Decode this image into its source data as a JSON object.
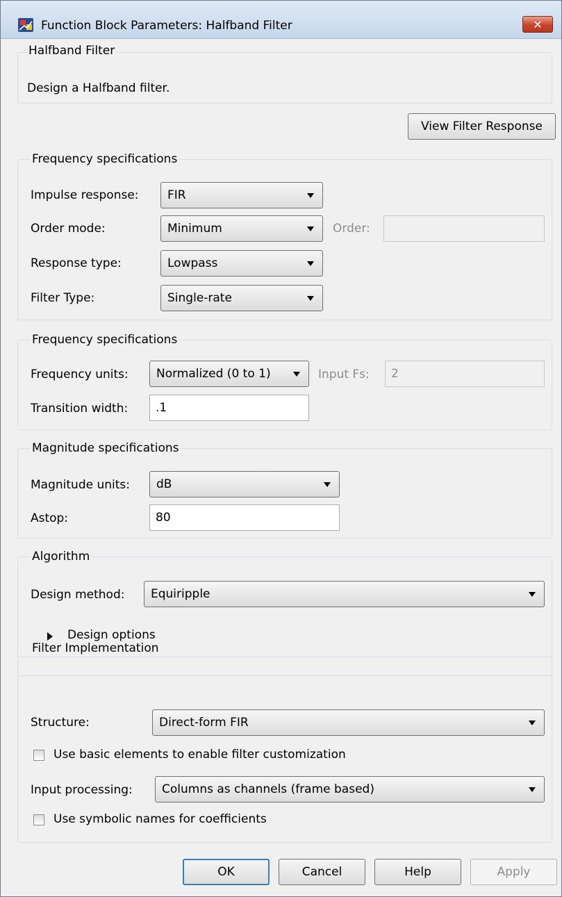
{
  "window": {
    "title": "Function Block Parameters: Halfband Filter",
    "close_glyph": "✕"
  },
  "header": {
    "group_title": "Halfband Filter",
    "description": "Design a Halfband filter."
  },
  "view_filter_response_label": "View Filter Response",
  "freq_spec1": {
    "title": "Frequency specifications",
    "impulse_label": "Impulse response:",
    "impulse_value": "FIR",
    "order_mode_label": "Order mode:",
    "order_mode_value": "Minimum",
    "order_label": "Order:",
    "order_value": "",
    "response_type_label": "Response type:",
    "response_type_value": "Lowpass",
    "filter_type_label": "Filter Type:",
    "filter_type_value": "Single-rate"
  },
  "freq_spec2": {
    "title": "Frequency specifications",
    "units_label": "Frequency units:",
    "units_value": "Normalized (0 to 1)",
    "input_fs_label": "Input Fs:",
    "input_fs_value": "2",
    "transition_label": "Transition width:",
    "transition_value": ".1"
  },
  "magnitude": {
    "title": "Magnitude specifications",
    "units_label": "Magnitude units:",
    "units_value": "dB",
    "astop_label": "Astop:",
    "astop_value": "80"
  },
  "algorithm": {
    "title": "Algorithm",
    "design_method_label": "Design method:",
    "design_method_value": "Equiripple",
    "design_options_label": "Design options"
  },
  "implementation": {
    "title": "Filter Implementation",
    "structure_label": "Structure:",
    "structure_value": "Direct-form FIR",
    "basic_elements_label": "Use basic elements to enable filter customization",
    "input_processing_label": "Input processing:",
    "input_processing_value": "Columns as channels (frame based)",
    "symbolic_names_label": "Use symbolic names for coefficients"
  },
  "buttons": {
    "ok": "OK",
    "cancel": "Cancel",
    "help": "Help",
    "apply": "Apply"
  },
  "colors": {
    "titlebar": "#c6d7eb",
    "close": "#c7452c",
    "dialog_bg": "#f0f0f0",
    "default_border": "#3c7fb1"
  }
}
